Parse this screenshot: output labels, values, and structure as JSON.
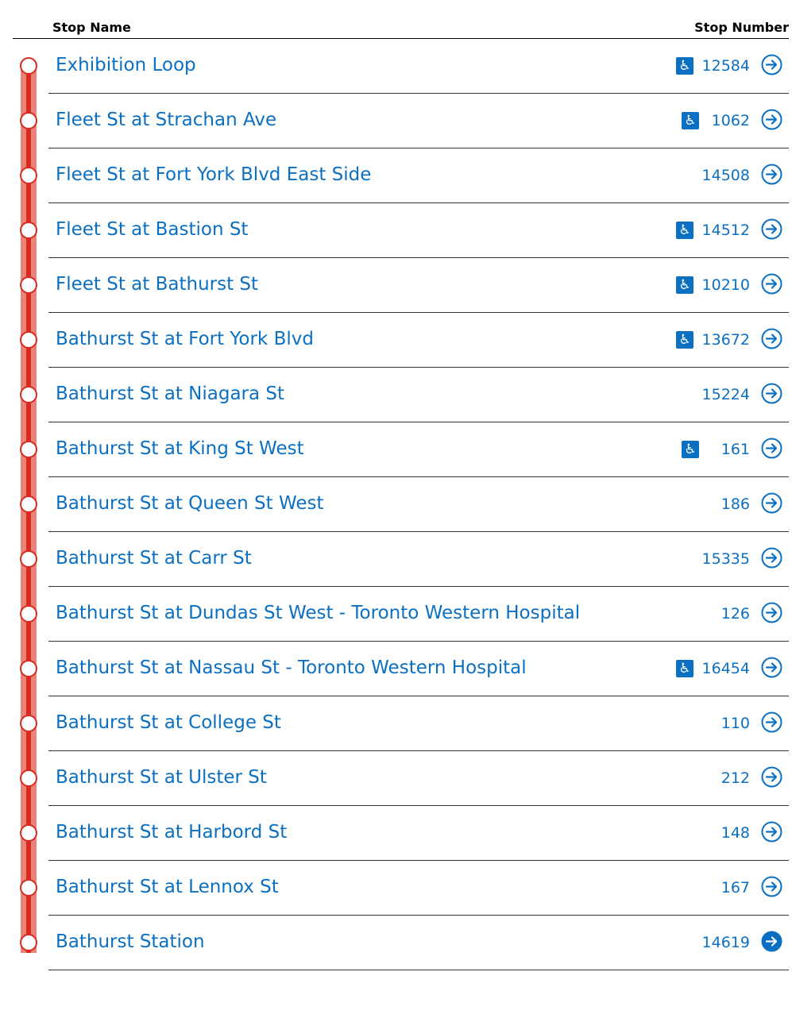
{
  "header": {
    "stop_name_label": "Stop Name",
    "stop_number_label": "Stop Number"
  },
  "colors": {
    "link": "#0b6fc2",
    "route_line": "#d62b1f",
    "route_halo": "#e8837c"
  },
  "stops": [
    {
      "name": "Exhibition Loop",
      "number": "12584",
      "accessible": true
    },
    {
      "name": "Fleet St at Strachan Ave",
      "number": "1062",
      "accessible": true
    },
    {
      "name": "Fleet St at Fort York Blvd East Side",
      "number": "14508",
      "accessible": false
    },
    {
      "name": "Fleet St at Bastion St",
      "number": "14512",
      "accessible": true
    },
    {
      "name": "Fleet St at Bathurst St",
      "number": "10210",
      "accessible": true
    },
    {
      "name": "Bathurst St at Fort York Blvd",
      "number": "13672",
      "accessible": true
    },
    {
      "name": "Bathurst St at Niagara St",
      "number": "15224",
      "accessible": false
    },
    {
      "name": "Bathurst St at King St West",
      "number": "161",
      "accessible": true
    },
    {
      "name": "Bathurst St at Queen St West",
      "number": "186",
      "accessible": false
    },
    {
      "name": "Bathurst St at Carr St",
      "number": "15335",
      "accessible": false
    },
    {
      "name": "Bathurst St at Dundas St West - Toronto Western Hospital",
      "number": "126",
      "accessible": false
    },
    {
      "name": "Bathurst St at Nassau St - Toronto Western Hospital",
      "number": "16454",
      "accessible": true
    },
    {
      "name": "Bathurst St at College St",
      "number": "110",
      "accessible": false
    },
    {
      "name": "Bathurst St at Ulster St",
      "number": "212",
      "accessible": false
    },
    {
      "name": "Bathurst St at Harbord St",
      "number": "148",
      "accessible": false
    },
    {
      "name": "Bathurst St at Lennox St",
      "number": "167",
      "accessible": false
    },
    {
      "name": "Bathurst Station",
      "number": "14619",
      "accessible": false,
      "arrow_filled": true
    }
  ]
}
